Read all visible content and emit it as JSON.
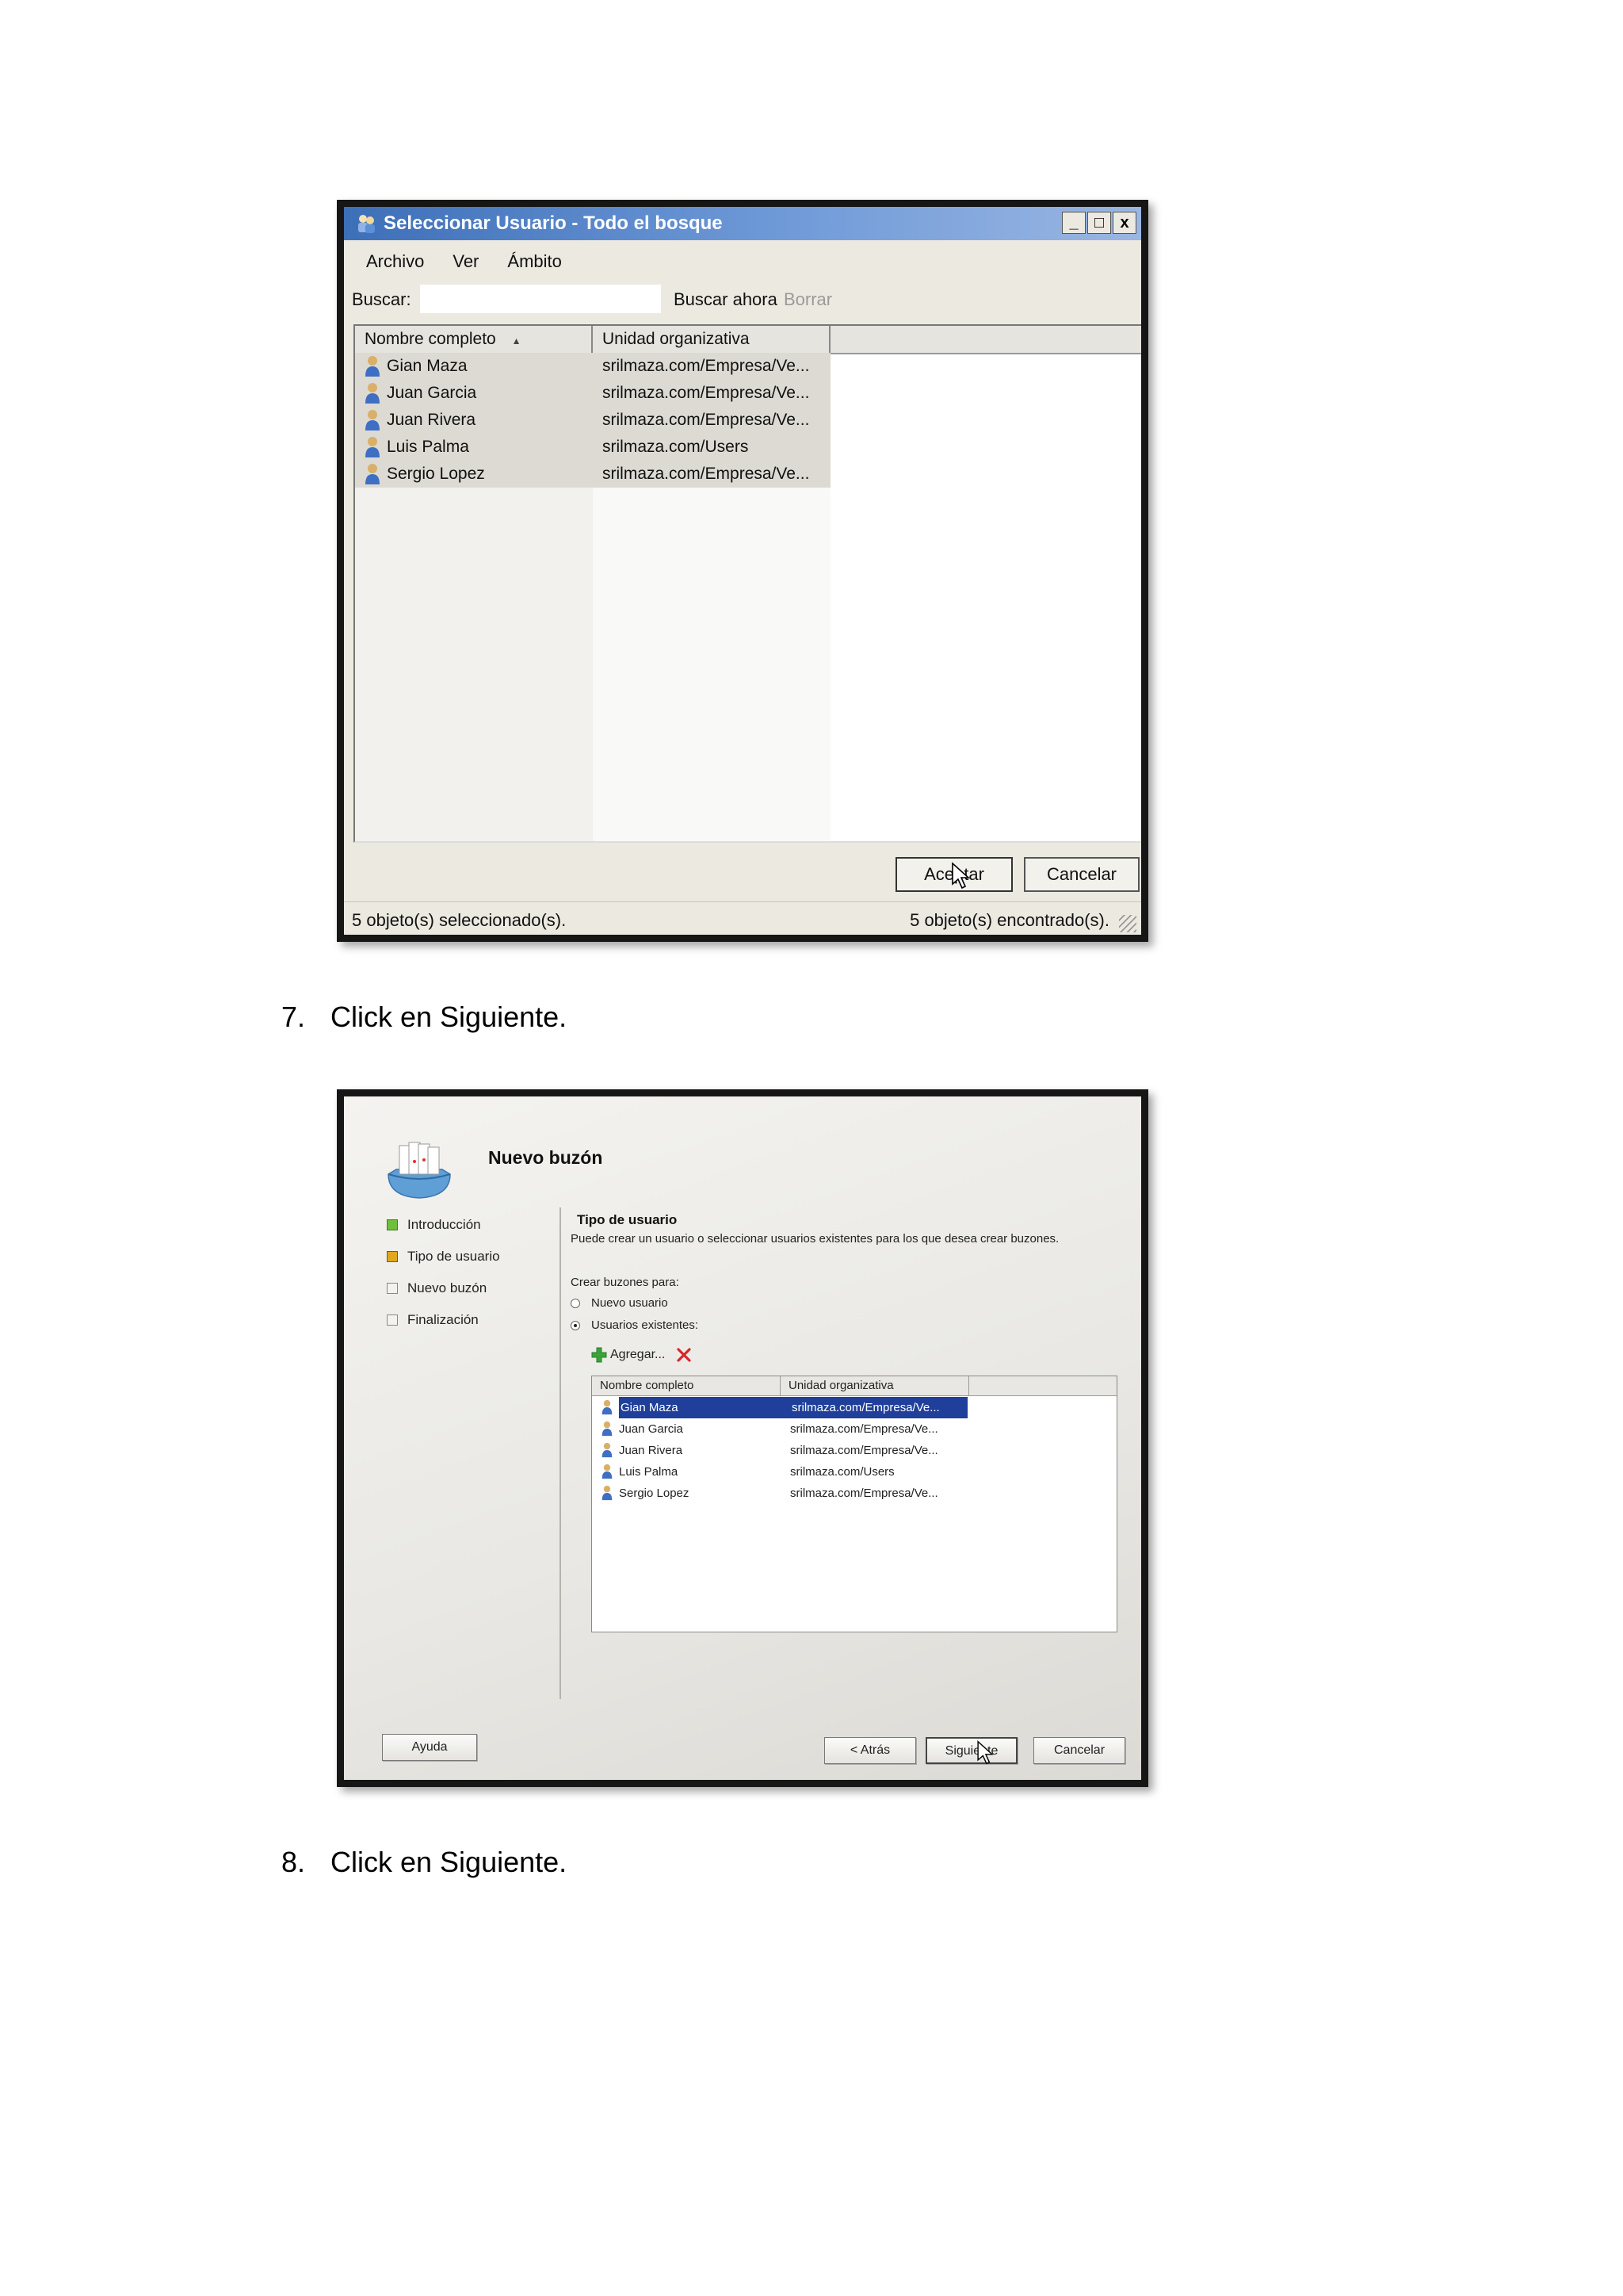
{
  "dialog1": {
    "title": "Seleccionar Usuario - Todo el bosque",
    "window_buttons": {
      "minimize": "_",
      "maximize": "□",
      "close": "x"
    },
    "menu": [
      "Archivo",
      "Ver",
      "Ámbito"
    ],
    "search": {
      "label": "Buscar:",
      "value": "",
      "search_now": "Buscar ahora",
      "clear": "Borrar"
    },
    "columns": [
      "Nombre completo",
      "Unidad organizativa"
    ],
    "sort_indicator": "▲",
    "rows": [
      {
        "name": "Gian Maza",
        "ou": "srilmaza.com/Empresa/Ve..."
      },
      {
        "name": "Juan Garcia",
        "ou": "srilmaza.com/Empresa/Ve..."
      },
      {
        "name": "Juan Rivera",
        "ou": "srilmaza.com/Empresa/Ve..."
      },
      {
        "name": "Luis Palma",
        "ou": "srilmaza.com/Users"
      },
      {
        "name": "Sergio Lopez",
        "ou": "srilmaza.com/Empresa/Ve..."
      }
    ],
    "buttons": {
      "ok": "Aceptar",
      "cancel": "Cancelar"
    },
    "status": {
      "selected": "5 objeto(s) seleccionado(s).",
      "found": "5 objeto(s) encontrado(s)."
    }
  },
  "steps": [
    {
      "number": "7.",
      "text": "Click en Siguiente."
    },
    {
      "number": "8.",
      "text": "Click en Siguiente."
    }
  ],
  "dialog2": {
    "title": "Nuevo buzón",
    "nav": [
      {
        "label": "Introducción",
        "state": "done"
      },
      {
        "label": "Tipo de usuario",
        "state": "current"
      },
      {
        "label": "Nuevo buzón",
        "state": "pending"
      },
      {
        "label": "Finalización",
        "state": "pending"
      }
    ],
    "section_title": "Tipo de usuario",
    "description": "Puede crear un usuario o seleccionar usuarios existentes para los que desea crear buzones.",
    "create_for_label": "Crear buzones para:",
    "options": [
      {
        "label": "Nuevo usuario",
        "selected": false
      },
      {
        "label": "Usuarios existentes:",
        "selected": true
      }
    ],
    "add_label": "Agregar...",
    "columns": [
      "Nombre completo",
      "Unidad organizativa"
    ],
    "rows": [
      {
        "name": "Gian Maza",
        "ou": "srilmaza.com/Empresa/Ve...",
        "selected": true
      },
      {
        "name": "Juan Garcia",
        "ou": "srilmaza.com/Empresa/Ve...",
        "selected": false
      },
      {
        "name": "Juan Rivera",
        "ou": "srilmaza.com/Empresa/Ve...",
        "selected": false
      },
      {
        "name": "Luis Palma",
        "ou": "srilmaza.com/Users",
        "selected": false
      },
      {
        "name": "Sergio Lopez",
        "ou": "srilmaza.com/Empresa/Ve...",
        "selected": false
      }
    ],
    "buttons": {
      "help": "Ayuda",
      "back": "< Atrás",
      "next": "Siguiente",
      "cancel": "Cancelar"
    }
  },
  "colors": {
    "titlebar": "#3d6fb8",
    "selection": "#1f3f9a",
    "nav_done": "#6fbf3a",
    "nav_current": "#e0a81a",
    "remove_icon": "#d8262a",
    "add_icon": "#3aa33a"
  }
}
